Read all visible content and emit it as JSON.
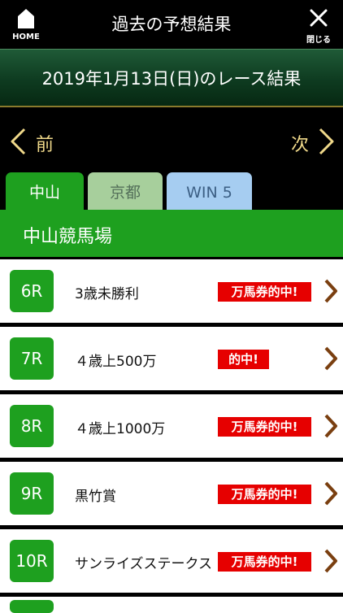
{
  "header": {
    "home_label": "HOME",
    "title": "過去の予想結果",
    "close_label": "閉じる"
  },
  "date_banner": "2019年1月13日(日)のレース結果",
  "nav": {
    "prev_label": "前",
    "next_label": "次"
  },
  "tabs": [
    {
      "label": "中山",
      "active": true
    },
    {
      "label": "京都",
      "active": false
    },
    {
      "label": "WIN 5",
      "active": false
    }
  ],
  "venue_title": "中山競馬場",
  "colors": {
    "green": "#1ea01f",
    "hit_red": "#e60000",
    "gold": "#f0d98a",
    "chevron": "#7a3f10"
  },
  "races": [
    {
      "race": "6R",
      "name": "3歳未勝利",
      "result": "万馬券的中!"
    },
    {
      "race": "7R",
      "name": "４歳上500万",
      "result": "的中!"
    },
    {
      "race": "8R",
      "name": "４歳上1000万",
      "result": "万馬券的中!"
    },
    {
      "race": "9R",
      "name": "黒竹賞",
      "result": "万馬券的中!"
    },
    {
      "race": "10R",
      "name": "サンライズステークス",
      "result": "万馬券的中!"
    }
  ]
}
